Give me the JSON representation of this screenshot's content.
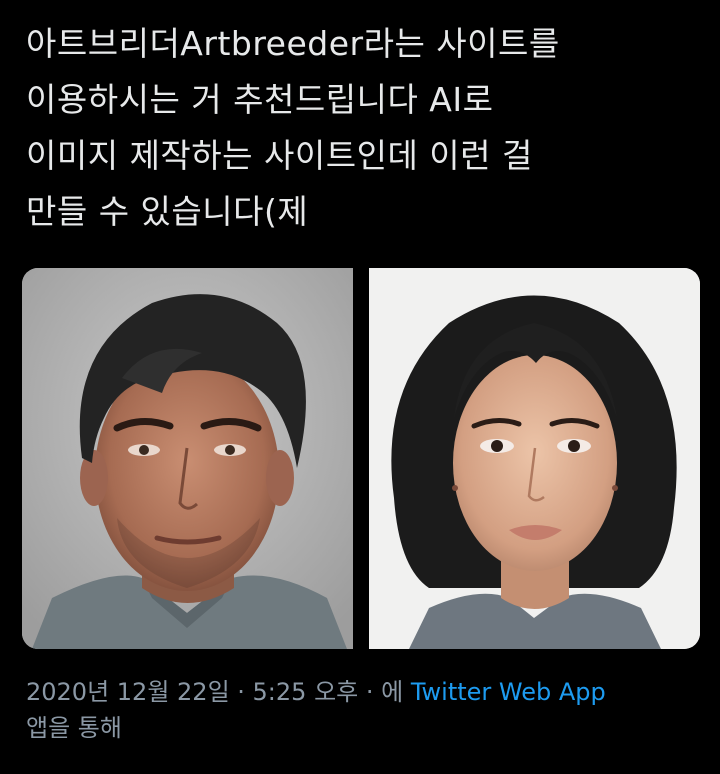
{
  "tweet": {
    "text_lines": [
      "아트브리더Artbreeder라는 사이트를",
      "이용하시는 거 추천드립니다 AI로",
      "이미지 제작하는 사이트인데 이런 걸",
      "만들 수 있습니다(제"
    ]
  },
  "media": {
    "photos": [
      {
        "subject": "male-portrait",
        "background": "#b9b9b9"
      },
      {
        "subject": "female-portrait",
        "background": "#f1f1f0"
      }
    ]
  },
  "meta": {
    "timestamp": "2020년 12월 22일 · 5:25 오후 · 에",
    "source_app": "Twitter Web App",
    "source_suffix": "앱을 통해"
  },
  "colors": {
    "background": "#000000",
    "text": "#e7e9ea",
    "muted": "#8b98a5",
    "link": "#1d9bf0"
  }
}
